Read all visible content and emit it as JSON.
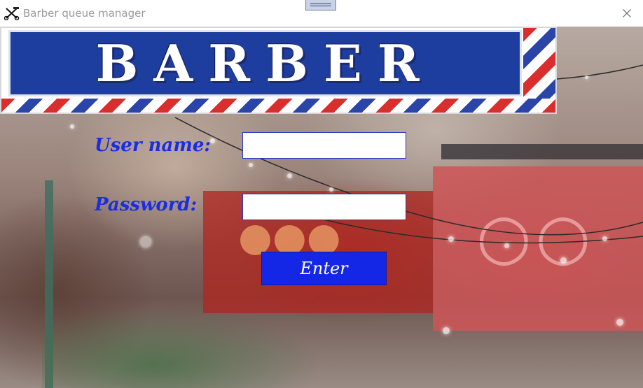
{
  "window": {
    "title": "Barber queue manager",
    "app_icon": "scissors-comb-icon",
    "close_icon": "close-icon"
  },
  "banner": {
    "text": "BARBER"
  },
  "form": {
    "username_label": "User name:",
    "username_value": "",
    "password_label": "Password:",
    "password_value": "",
    "enter_label": "Enter"
  },
  "colors": {
    "label": "#1a2ee0",
    "button": "#1427e6",
    "banner_blue": "#1e3e9f"
  }
}
